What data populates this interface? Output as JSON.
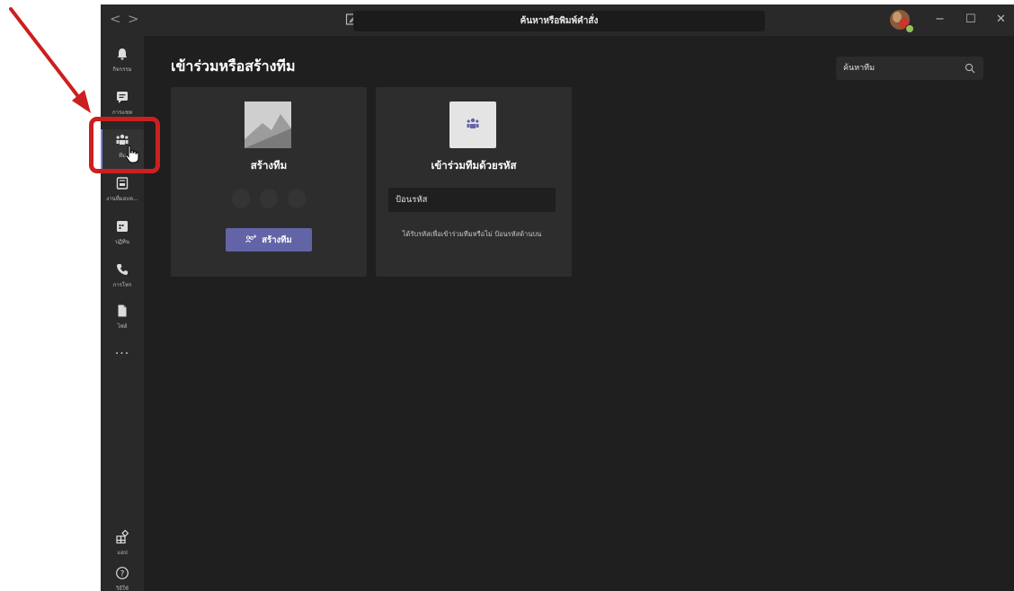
{
  "titlebar": {
    "back_glyph": "<",
    "forward_glyph": ">",
    "command_bar_placeholder": "ค้นหาหรือพิมพ์คำสั่ง",
    "minimize_glyph": "−",
    "maximize_glyph": "☐",
    "close_glyph": "✕"
  },
  "rail": {
    "items": [
      {
        "label": "กิจกรรม",
        "icon": "bell-icon"
      },
      {
        "label": "การแชท",
        "icon": "chat-icon"
      },
      {
        "label": "ทีม",
        "icon": "teams-icon"
      },
      {
        "label": "งานที่มอบห...",
        "icon": "assignments-icon"
      },
      {
        "label": "ปฏิทิน",
        "icon": "calendar-icon"
      },
      {
        "label": "การโทร",
        "icon": "phone-icon"
      },
      {
        "label": "ไฟล์",
        "icon": "file-icon"
      }
    ],
    "more_glyph": "...",
    "apps_label": "แอป",
    "help_label": "วิธีใช้",
    "help_glyph": "?"
  },
  "main": {
    "title": "เข้าร่วมหรือสร้างทีม",
    "search_placeholder": "ค้นหาทีม"
  },
  "create_card": {
    "title": "สร้างทีม",
    "button_label": "สร้างทีม"
  },
  "join_card": {
    "title": "เข้าร่วมทีมด้วยรหัส",
    "code_placeholder": "ป้อนรหัส",
    "hint": "ได้รับรหัสเพื่อเข้าร่วมทีมหรือไม่ ป้อนรหัสด้านบน"
  },
  "colors": {
    "accent": "#6264a7",
    "annotation": "#cc1f1f",
    "background": "#1f1f1f",
    "rail": "#292929",
    "card": "#2d2d2d"
  }
}
